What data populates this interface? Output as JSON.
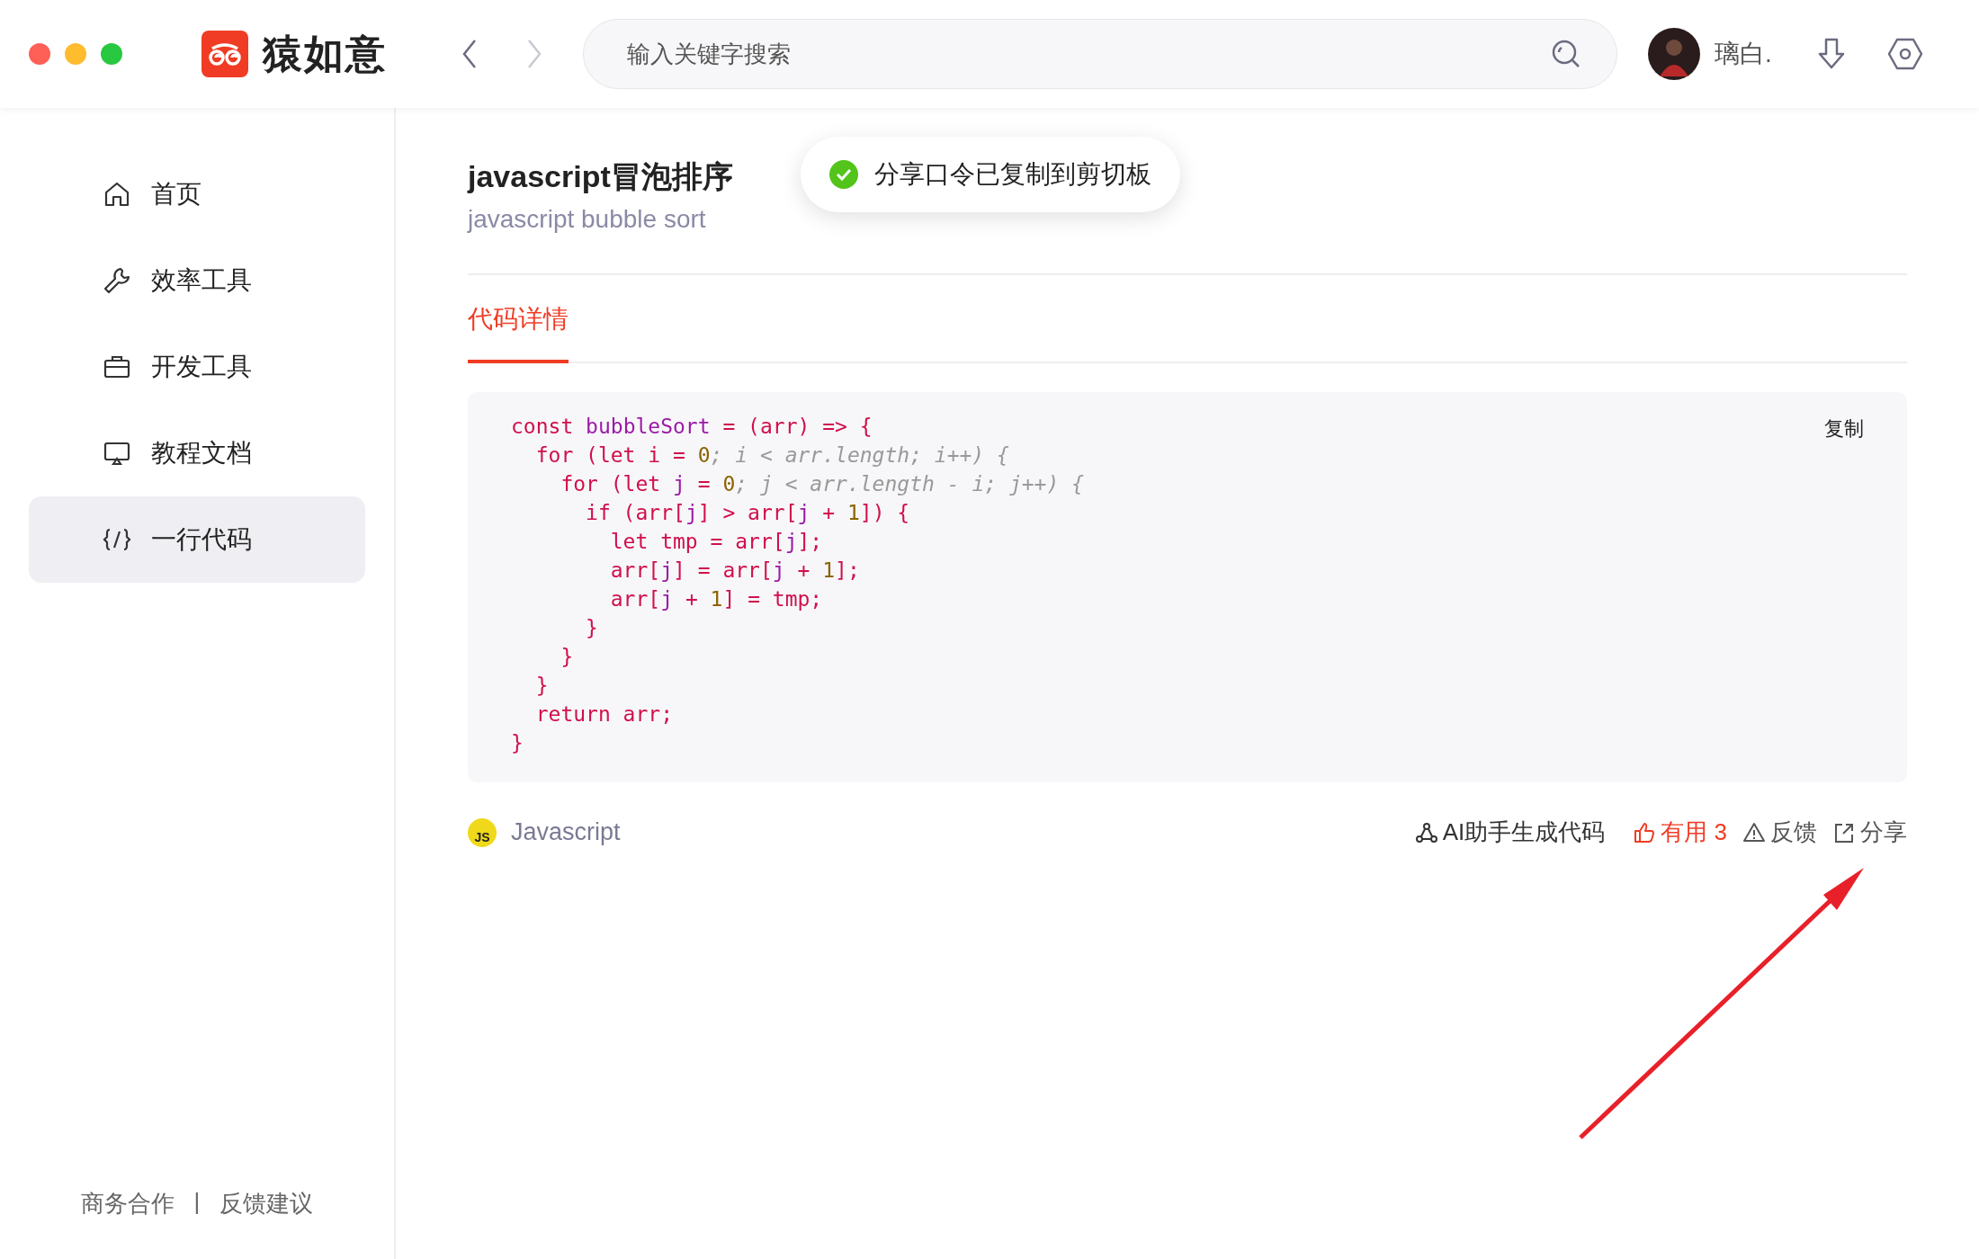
{
  "app": {
    "name": "猿如意"
  },
  "search": {
    "placeholder": "输入关键字搜索"
  },
  "user": {
    "name": "璃白."
  },
  "sidebar": {
    "items": [
      {
        "label": "首页",
        "selected": false
      },
      {
        "label": "效率工具",
        "selected": false
      },
      {
        "label": "开发工具",
        "selected": false
      },
      {
        "label": "教程文档",
        "selected": false
      },
      {
        "label": "一行代码",
        "selected": true
      }
    ],
    "footer_links": [
      "商务合作",
      "反馈建议"
    ],
    "footer_separator": "|"
  },
  "snippet": {
    "title": "javascript冒泡排序",
    "subtitle": "javascript bubble sort",
    "tabs": [
      {
        "label": "代码详情",
        "selected": true
      }
    ],
    "copy_button": "复制",
    "code_lines": [
      [
        {
          "text": "const ",
          "kind": "keyword"
        },
        {
          "text": "bubbleSort",
          "kind": "name"
        },
        {
          "text": " = (arr) => {",
          "kind": "keyword"
        }
      ],
      [
        {
          "text": "  for (let i = ",
          "kind": "keyword"
        },
        {
          "text": "0",
          "kind": "number"
        },
        {
          "text": "; i < arr.length; i++) {",
          "kind": "comment"
        }
      ],
      [
        {
          "text": "    for (let ",
          "kind": "keyword"
        },
        {
          "text": "j",
          "kind": "name"
        },
        {
          "text": " = ",
          "kind": "keyword"
        },
        {
          "text": "0",
          "kind": "number"
        },
        {
          "text": "; j < arr.length - i; j++) {",
          "kind": "comment"
        }
      ],
      [
        {
          "text": "      if (arr[",
          "kind": "keyword"
        },
        {
          "text": "j",
          "kind": "name"
        },
        {
          "text": "] > arr[",
          "kind": "keyword"
        },
        {
          "text": "j",
          "kind": "name"
        },
        {
          "text": " + ",
          "kind": "keyword"
        },
        {
          "text": "1",
          "kind": "number"
        },
        {
          "text": "]) {",
          "kind": "keyword"
        }
      ],
      [
        {
          "text": "        let tmp = arr[",
          "kind": "keyword"
        },
        {
          "text": "j",
          "kind": "name"
        },
        {
          "text": "];",
          "kind": "keyword"
        }
      ],
      [
        {
          "text": "        arr[",
          "kind": "keyword"
        },
        {
          "text": "j",
          "kind": "name"
        },
        {
          "text": "] = arr[",
          "kind": "keyword"
        },
        {
          "text": "j",
          "kind": "name"
        },
        {
          "text": " + ",
          "kind": "keyword"
        },
        {
          "text": "1",
          "kind": "number"
        },
        {
          "text": "];",
          "kind": "keyword"
        }
      ],
      [
        {
          "text": "        arr[",
          "kind": "keyword"
        },
        {
          "text": "j",
          "kind": "name"
        },
        {
          "text": " + ",
          "kind": "keyword"
        },
        {
          "text": "1",
          "kind": "number"
        },
        {
          "text": "] = tmp;",
          "kind": "keyword"
        }
      ],
      [
        {
          "text": "      }",
          "kind": "keyword"
        }
      ],
      [
        {
          "text": "    }",
          "kind": "keyword"
        }
      ],
      [
        {
          "text": "  }",
          "kind": "keyword"
        }
      ],
      [
        {
          "text": "  return arr;",
          "kind": "keyword"
        }
      ],
      [
        {
          "text": "}",
          "kind": "keyword"
        }
      ]
    ],
    "language": "Javascript",
    "language_badge": "JS",
    "actions": [
      {
        "kind": "ai",
        "label": "AI助手生成代码"
      },
      {
        "kind": "like",
        "label": "有用 3",
        "active": true
      },
      {
        "kind": "feedback",
        "label": "反馈"
      },
      {
        "kind": "share",
        "label": "分享"
      }
    ]
  },
  "toast": {
    "message": "分享口令已复制到剪切板"
  }
}
